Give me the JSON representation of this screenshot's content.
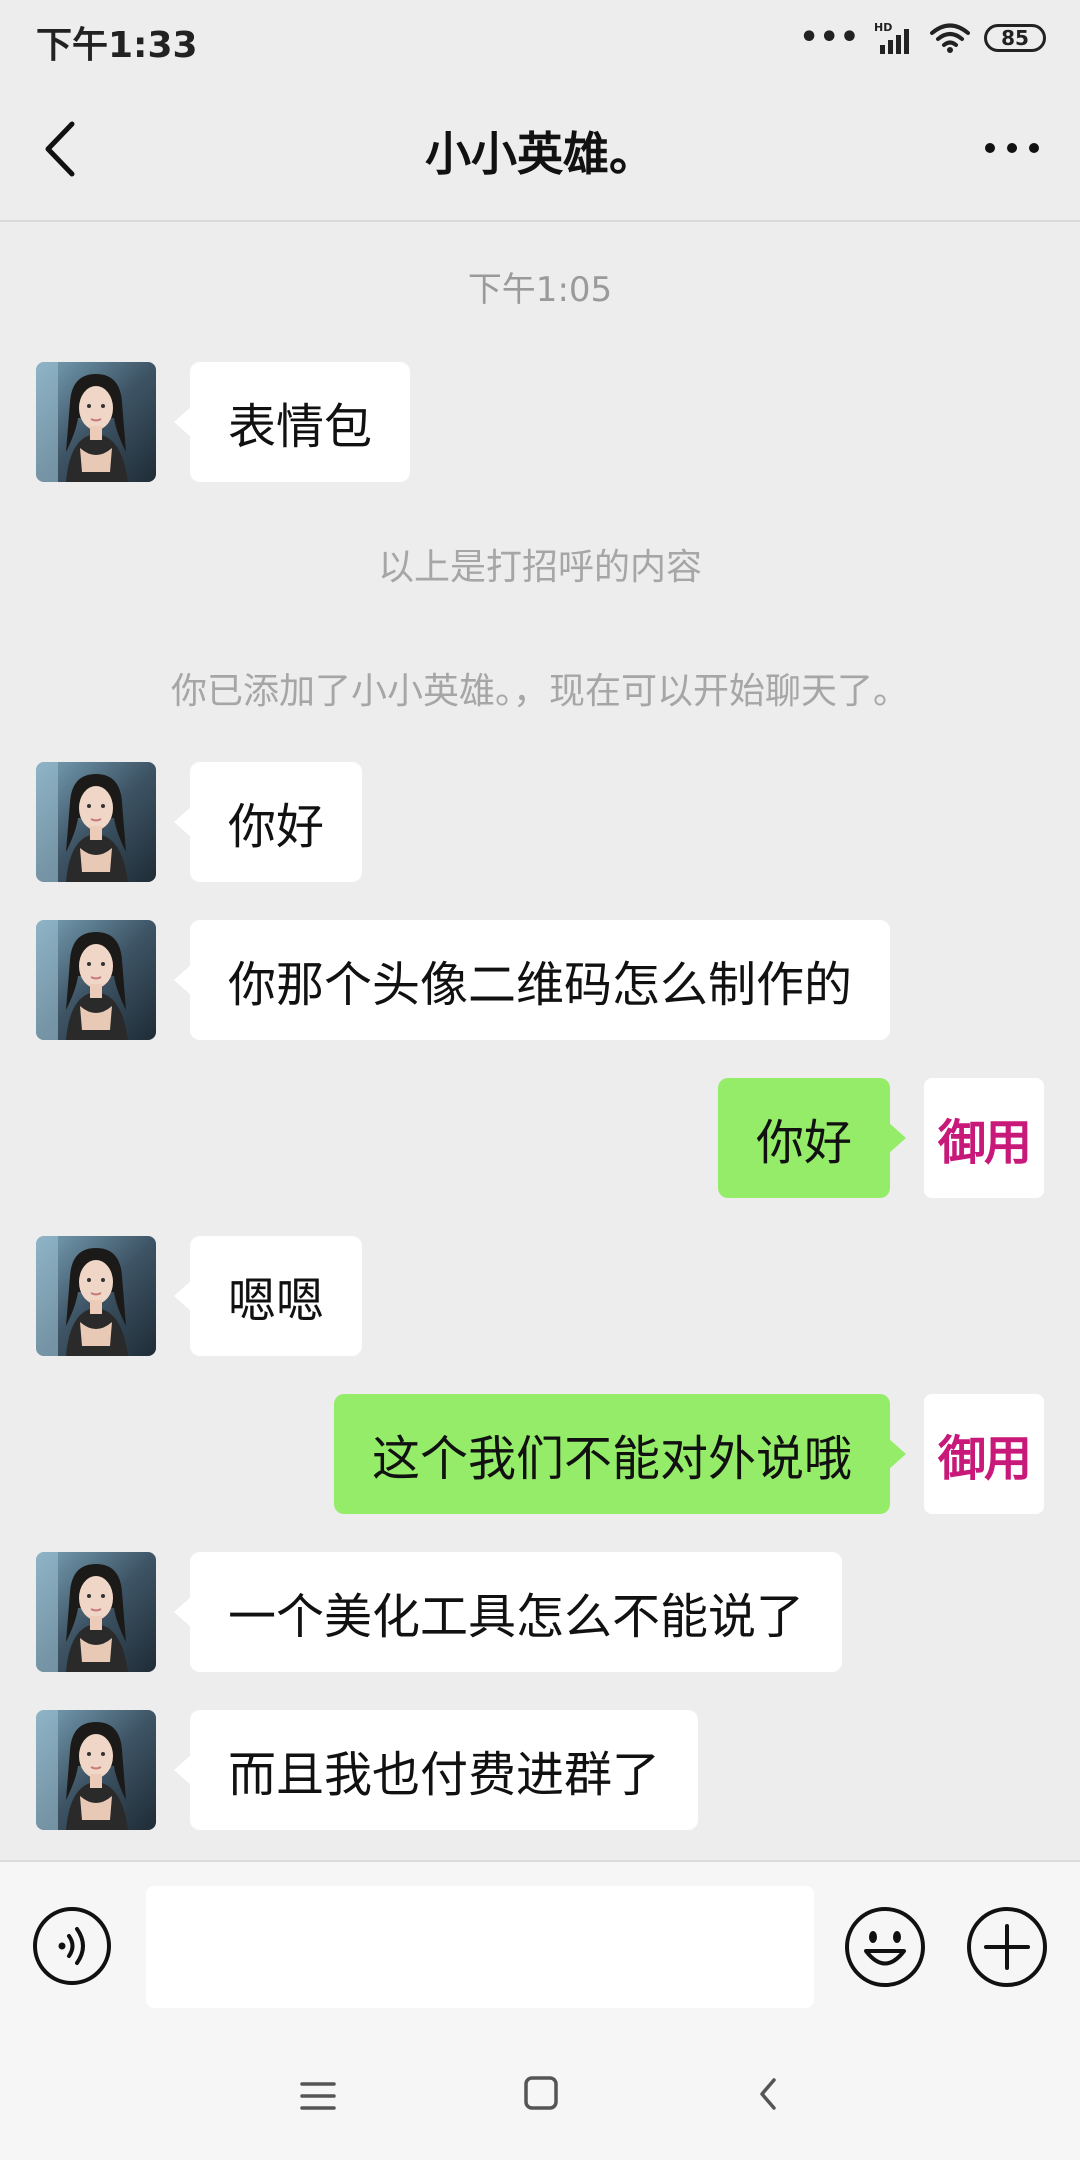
{
  "status_bar": {
    "time": "下午1:33",
    "network": "HD",
    "battery": "85"
  },
  "header": {
    "title": "小小英雄。",
    "back_icon": "chevron-left-icon",
    "more_icon": "more-dots-icon"
  },
  "chat": {
    "timestamp": "下午1:05",
    "greeting_message": "表情包",
    "system_notes": [
      "以上是打招呼的内容",
      "你已添加了小小英雄。，现在可以开始聊天了。"
    ],
    "messages": [
      {
        "sender": "them",
        "text": "你好"
      },
      {
        "sender": "them",
        "text": "你那个头像二维码怎么制作的"
      },
      {
        "sender": "me",
        "text": "你好"
      },
      {
        "sender": "them",
        "text": "嗯嗯"
      },
      {
        "sender": "me",
        "text": "这个我们不能对外说哦"
      },
      {
        "sender": "them",
        "text": "一个美化工具怎么不能说了"
      },
      {
        "sender": "them",
        "text": "而且我也付费进群了"
      }
    ],
    "my_avatar_text": "御用"
  },
  "input_bar": {
    "value": "",
    "voice_icon": "voice-icon",
    "emoji_icon": "emoji-icon",
    "plus_icon": "plus-icon"
  },
  "colors": {
    "background": "#ededed",
    "my_bubble": "#95ec69",
    "their_bubble": "#ffffff",
    "avatar_text": "#c8187a"
  }
}
